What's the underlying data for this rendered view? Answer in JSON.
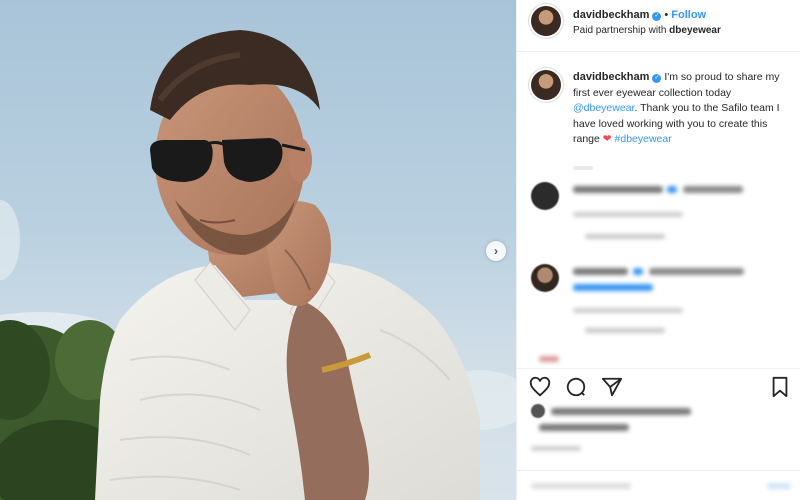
{
  "post": {
    "username": "davidbeckham",
    "follow_label": "Follow",
    "partnership_prefix": "Paid partnership with ",
    "partner": "dbeyewear",
    "caption": {
      "username": "davidbeckham",
      "text_1": " I'm so proud to share my first ever eyewear collection today ",
      "mention": "@dbeyewear",
      "text_2": ". Thank you to the Safilo team I have loved working with you to create this range ",
      "heart": "❤",
      "hashtag": " #dbeyewear"
    }
  },
  "icons": {
    "verified": "verified-badge-icon",
    "carousel_next": "chevron-right-icon",
    "like": "heart-icon",
    "comment": "comment-bubble-icon",
    "share": "paper-plane-icon",
    "save": "bookmark-icon"
  },
  "colors": {
    "link_blue": "#3897f0",
    "heart_red": "#ed4956",
    "text": "#262626",
    "border": "#efefef"
  }
}
